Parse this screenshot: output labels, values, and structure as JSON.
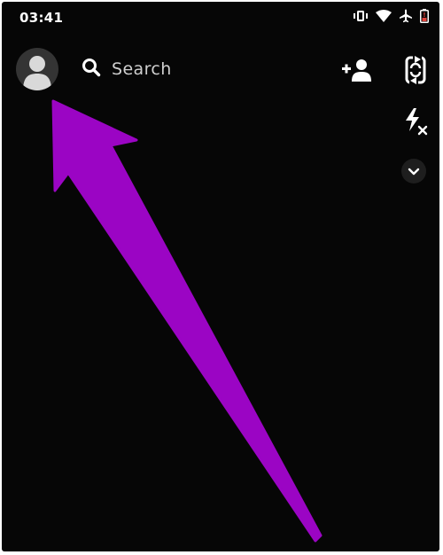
{
  "status_bar": {
    "time": "03:41",
    "icons": [
      "vibrate-icon",
      "wifi-icon",
      "airplane-icon",
      "battery-low-icon"
    ]
  },
  "header": {
    "avatar_icon": "user-silhouette-icon",
    "search": {
      "icon": "search-icon",
      "label": "Search"
    },
    "add_friend_icon": "add-friend-icon",
    "flip_camera_icon": "flip-camera-icon"
  },
  "camera_tools": {
    "flash_icon": "flash-off-icon",
    "more_icon": "chevron-down-icon"
  },
  "annotation": {
    "arrow_color": "#9b05c4",
    "points_to": "avatar"
  },
  "colors": {
    "background": "#060606",
    "text": "#ffffff",
    "muted_text": "#cfcfcf",
    "battery_low": "#e0423a"
  }
}
